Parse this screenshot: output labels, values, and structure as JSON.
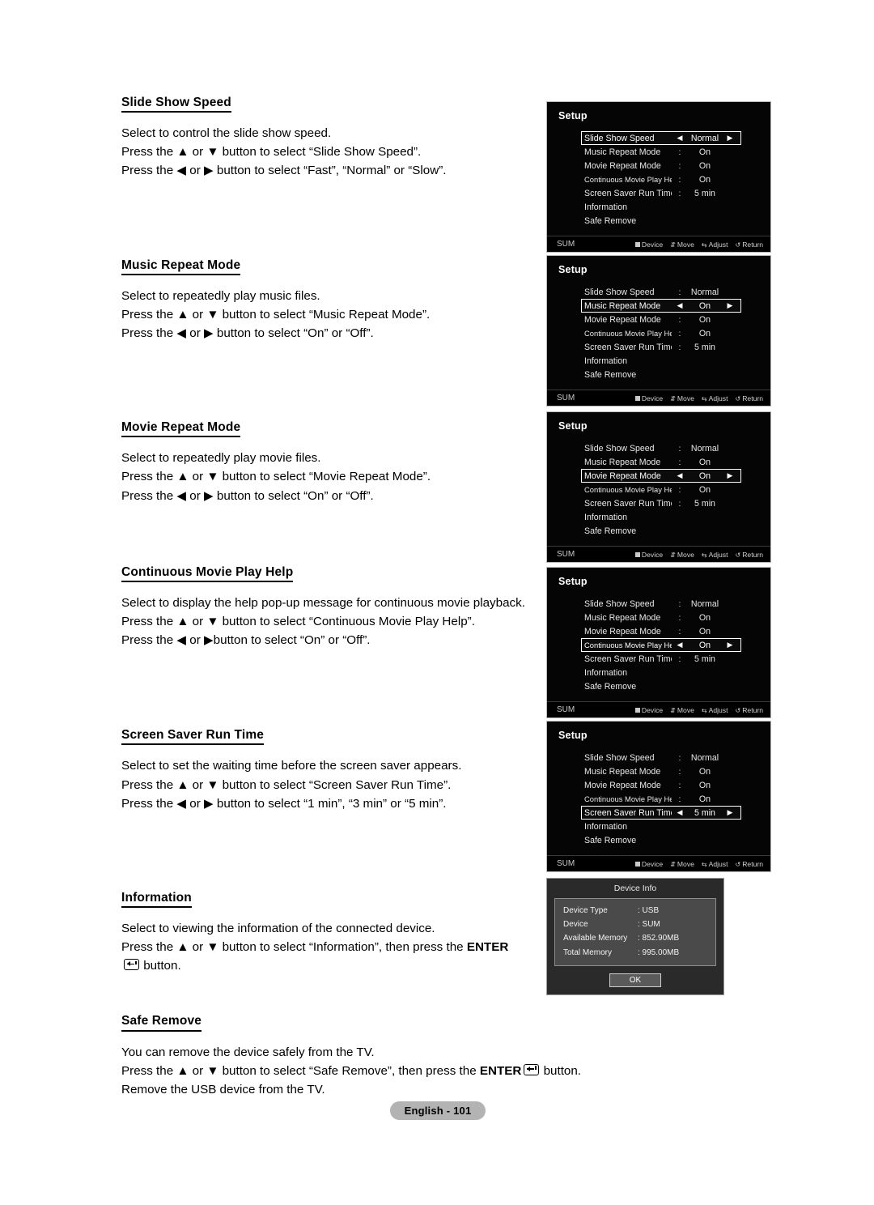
{
  "page": {
    "footer_label": "English - 101"
  },
  "sections": [
    {
      "title": "Slide Show Speed",
      "lines": [
        "Select to control the slide show speed.",
        "Press the ▲ or ▼ button to select “Slide Show Speed”.",
        "Press the ◀ or ▶ button to select “Fast”, “Normal” or “Slow”."
      ]
    },
    {
      "title": "Music Repeat Mode",
      "lines": [
        "Select to repeatedly play music files.",
        "Press the ▲ or ▼ button to select “Music Repeat Mode”.",
        "Press the ◀ or ▶ button to select “On” or “Off”."
      ]
    },
    {
      "title": "Movie Repeat Mode",
      "lines": [
        "Select to repeatedly play movie files.",
        "Press the ▲ or ▼ button to select “Movie Repeat Mode”.",
        "Press the ◀ or ▶ button to select “On” or “Off”."
      ]
    },
    {
      "title": "Continuous Movie Play Help",
      "lines": [
        "Select to display the help pop-up message for continuous movie playback.",
        "Press the ▲ or ▼ button to select “Continuous Movie Play Help”.",
        "Press the ◀ or ▶button to select “On” or “Off”."
      ]
    },
    {
      "title": "Screen Saver Run Time",
      "lines": [
        "Select to set the waiting time before the screen saver appears.",
        "Press the ▲ or ▼ button to select “Screen Saver Run Time”.",
        "Press the ◀ or ▶ button to select “1 min”, “3 min” or “5 min”."
      ]
    },
    {
      "title": "Information",
      "lines": [
        "Select to viewing the information of the connected device."
      ],
      "enter_line": {
        "pre": "Press the ▲ or ▼ button to select “Information”, then press the ",
        "bold": "ENTER",
        "post": " button."
      }
    },
    {
      "title": "Safe Remove",
      "lines": [
        "You can remove the device safely from the TV."
      ],
      "enter_line": {
        "pre": "Press the ▲ or ▼ button to select “Safe Remove”, then press the ",
        "bold": "ENTER",
        "post": " button."
      },
      "lines_after": [
        "Remove the USB device from the TV."
      ]
    }
  ],
  "osd": {
    "title": "Setup",
    "device_name": "SUM",
    "hints": [
      {
        "icon": "square-icon",
        "label": "Device"
      },
      {
        "icon": "up-down-arrow-icon",
        "label": "Move"
      },
      {
        "icon": "left-right-arrow-icon",
        "label": "Adjust"
      },
      {
        "icon": "return-arrow-icon",
        "label": "Return"
      }
    ],
    "menu_items": [
      {
        "label": "Slide Show Speed",
        "value": "Normal"
      },
      {
        "label": "Music Repeat Mode",
        "value": "On"
      },
      {
        "label": "Movie Repeat Mode",
        "value": "On"
      },
      {
        "label": "Continuous Movie Play Help",
        "value": "On"
      },
      {
        "label": "Screen Saver Run Time",
        "value": "5 min"
      },
      {
        "label": "Information",
        "value": ""
      },
      {
        "label": "Safe Remove",
        "value": ""
      }
    ],
    "separator": ":",
    "left_triangle": "◀",
    "right_triangle": "▶",
    "panels": [
      {
        "selected_index": 0
      },
      {
        "selected_index": 1
      },
      {
        "selected_index": 2
      },
      {
        "selected_index": 3
      },
      {
        "selected_index": 4
      }
    ]
  },
  "device_info": {
    "title": "Device Info",
    "rows": [
      {
        "key": "Device Type",
        "value": ": USB"
      },
      {
        "key": "Device",
        "value": ": SUM"
      },
      {
        "key": "Available Memory",
        "value": ": 852.90MB"
      },
      {
        "key": "Total Memory",
        "value": ": 995.00MB"
      }
    ],
    "ok_label": "OK"
  }
}
